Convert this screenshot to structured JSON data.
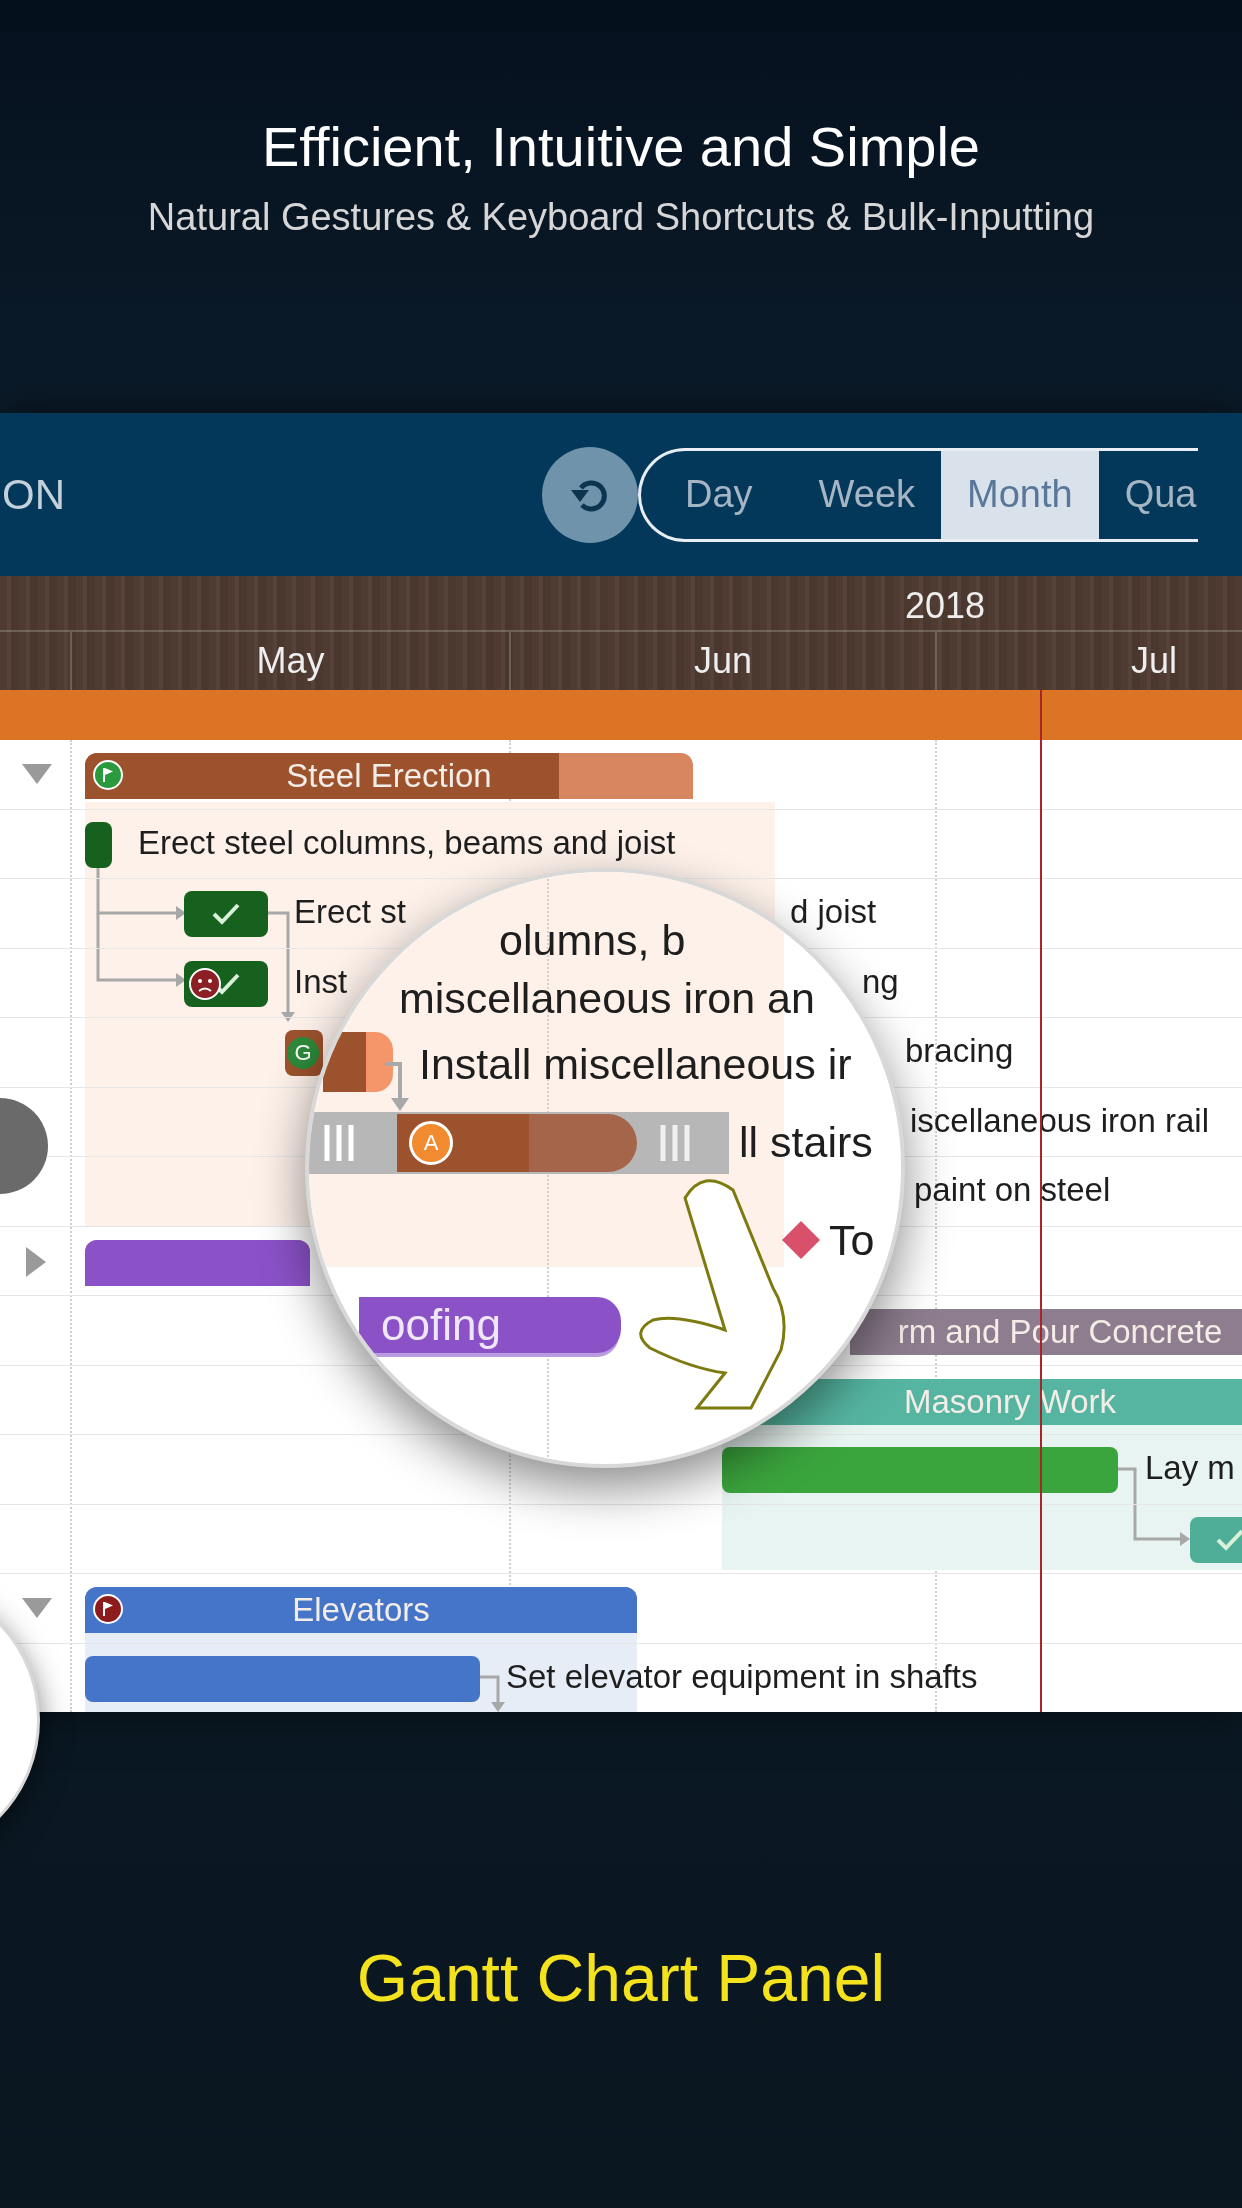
{
  "header": {
    "title": "Efficient, Intuitive and Simple",
    "subtitle": "Natural Gestures & Keyboard Shortcuts & Bulk-Inputting"
  },
  "toolbar": {
    "title": "ON",
    "scale_tabs": [
      {
        "label": "Day",
        "selected": false
      },
      {
        "label": "Week",
        "selected": false
      },
      {
        "label": "Month",
        "selected": true
      },
      {
        "label": "Qua",
        "selected": false
      }
    ]
  },
  "timeline": {
    "year": "2018",
    "months": [
      "May",
      "Jun",
      "Jul"
    ]
  },
  "rows": [
    {
      "kind": "group",
      "label": "Steel Erection",
      "expanded": true,
      "color": "#9c522d",
      "level": 0.78,
      "flag": {
        "color": "#2a9a3c"
      }
    },
    {
      "kind": "task",
      "label": "Erect steel columns, beams and joist",
      "color": "#17611f",
      "done": false,
      "warning": false
    },
    {
      "kind": "task",
      "label": "Erect st",
      "tail": "d joist",
      "color": "#17611f",
      "done": true,
      "warning": false
    },
    {
      "kind": "task",
      "label": "Inst",
      "tail": "ng",
      "color": "#17611f",
      "done": true,
      "warning": true
    },
    {
      "kind": "task",
      "tail": "bracing",
      "color": "#9c522d",
      "badge": "G",
      "done": false,
      "warning": false
    },
    {
      "kind": "task",
      "tail": "iscellaneous iron rail"
    },
    {
      "kind": "task",
      "tail": "paint on steel"
    },
    {
      "kind": "group",
      "expanded": false,
      "color": "#8b52c8",
      "level": 1
    },
    {
      "kind": "group",
      "label": "rm and Pour Concrete",
      "color": "#8d7d8e",
      "level": 1
    },
    {
      "kind": "group",
      "label": "Masonry Work",
      "color": "#55b5a0",
      "level": 1
    },
    {
      "kind": "task",
      "label": "Lay m",
      "color": "#3ba53d",
      "done": false,
      "warning": false
    },
    {
      "kind": "task",
      "color": "#4fae98",
      "done": true,
      "warning": false
    },
    {
      "kind": "group",
      "label": "Elevators",
      "expanded": true,
      "color": "#4575c8",
      "level": 1,
      "flag": {
        "color": "#8e1c1c"
      }
    },
    {
      "kind": "task",
      "label": "Set elevator equipment in shafts",
      "color": "#4575c8",
      "done": false,
      "warning": false
    }
  ],
  "magnifier": {
    "items": [
      {
        "kind": "text",
        "text": "olumns, b"
      },
      {
        "kind": "text",
        "text": "miscellaneous iron an"
      },
      {
        "kind": "task",
        "text": "Install miscellaneous ir"
      },
      {
        "kind": "bar",
        "badge": "A"
      },
      {
        "kind": "text",
        "text": "ll stairs"
      },
      {
        "kind": "milestone",
        "text": "To"
      },
      {
        "kind": "group",
        "text": "oofing"
      }
    ]
  },
  "caption": "Gantt Chart Panel"
}
